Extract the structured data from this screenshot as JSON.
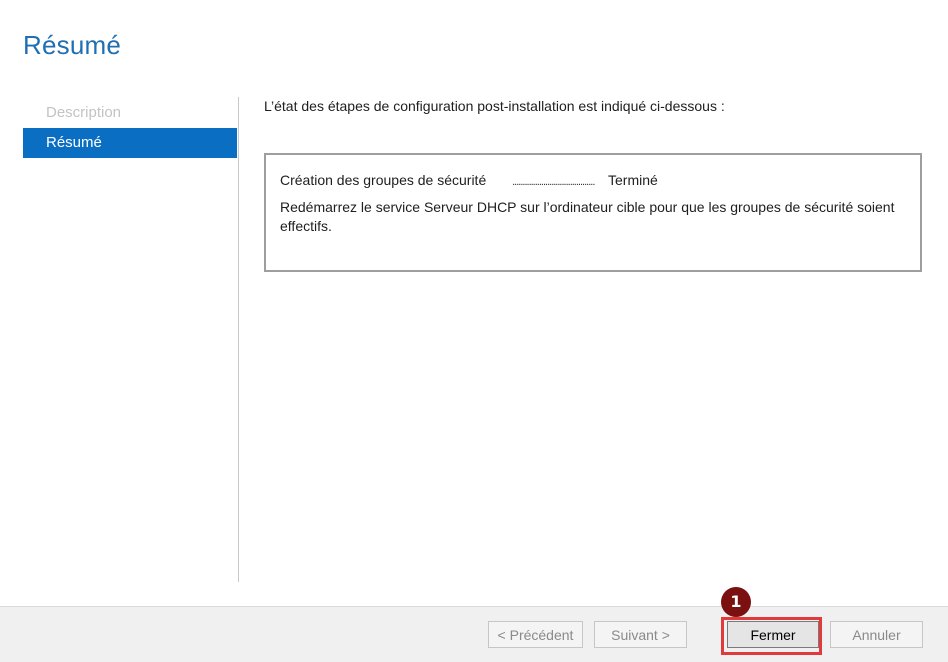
{
  "page": {
    "title": "Résumé"
  },
  "nav": {
    "items": [
      {
        "label": "Description",
        "state": "disabled"
      },
      {
        "label": "Résumé",
        "state": "active"
      }
    ]
  },
  "main": {
    "intro": "L’état des étapes de configuration post-installation est indiqué ci-dessous :",
    "result": {
      "task": "Création des groupes de sécurité",
      "dots": "........................................",
      "status": "Terminé",
      "message": "Redémarrez le service Serveur DHCP sur l’ordinateur cible pour que les groupes de sécurité soient effectifs."
    }
  },
  "footer": {
    "previous_label": "< Précédent",
    "next_label": "Suivant >",
    "close_label": "Fermer",
    "cancel_label": "Annuler"
  },
  "annotation": {
    "step_number": "1",
    "highlight_color": "#e03a3a",
    "badge_color": "#7a1010"
  },
  "colors": {
    "title": "#1f6fb2",
    "nav_active_bg": "#0a6fc2"
  }
}
